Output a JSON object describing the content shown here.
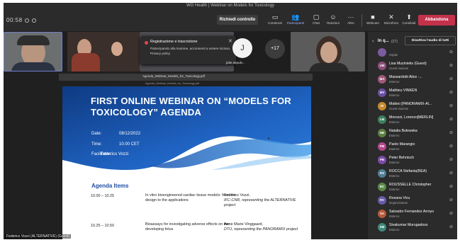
{
  "window": {
    "title": "WG Health | Webinar on Models for Toxicology",
    "timer": "00:58"
  },
  "toolbar": {
    "request_control": "Richiedi controllo",
    "buttons": [
      {
        "label": "Contenuti",
        "icon": "content-icon"
      },
      {
        "label": "Partecipanti",
        "icon": "people-icon"
      },
      {
        "label": "Chat",
        "icon": "chat-icon"
      },
      {
        "label": "Reazioni",
        "icon": "reactions-icon"
      },
      {
        "label": "Altro",
        "icon": "more-icon"
      },
      {
        "label": "Webcam",
        "icon": "camera-icon"
      },
      {
        "label": "Microfono",
        "icon": "mic-off-icon"
      },
      {
        "label": "Condividi",
        "icon": "share-icon"
      }
    ],
    "leave": "Abbandona"
  },
  "recording_popup": {
    "title": "Registrazione e trascrizione",
    "body": "Partecipando alla riunione, acconsenti a essere incluso. Privacy policy"
  },
  "gallery": {
    "avatar_initial": "J",
    "avatar_name": "joke.sepulv...",
    "overflow_count": "+17"
  },
  "document": {
    "filename": "Agenda_Webinar_Models_for_Toxicology.pdf",
    "subtitle": "Agenda_Webinar_Models_for_Toxicology.pdf"
  },
  "slide": {
    "title": "FIRST ONLINE WEBINAR ON “MODELS FOR TOXICOLOGY” AGENDA",
    "date_label": "Date:",
    "date_value": "08/12/2022",
    "time_label": "Time:",
    "time_value": "10.00 CET",
    "facilitator_label": "Facilitator:",
    "facilitator_value": "Federico Vozzi",
    "agenda_heading": "Agenda Items",
    "items": [
      {
        "time": "10.00 – 10.25",
        "title": "In vitro bioengineered cardiac tissue models: from the design to the applications",
        "speaker": "Federico Vozzi,",
        "affiliation": "IFC-CNR, representing the ALTERNATIVE project"
      },
      {
        "time": "10.25 – 10.50",
        "title": "Bioassays for investigating adverse effects on the developing fetus",
        "speaker": "Anne Marie Vinggaard,",
        "affiliation": "DTU, representing the PANORAMIX project"
      }
    ]
  },
  "presenter_tag": "Federico Vozzi (ALTERNATIVE) (Guest)",
  "panel": {
    "label": "In q...",
    "count": "(27)",
    "mute_all": "Disattiva l'audio di tutti",
    "participants": [
      {
        "initials": "",
        "name": "",
        "role": "Ospite",
        "color": "#7a5c9e"
      },
      {
        "initials": "UM",
        "name": "Lisa Muzinieks (Guest)",
        "role": "Guest riunione",
        "color": "#8e4f7a"
      },
      {
        "initials": "MA",
        "name": "Massardotti Alice -...",
        "role": "Esterno",
        "color": "#a2587b"
      },
      {
        "initials": "MV",
        "name": "Mathieu VINKEN",
        "role": "Esterno",
        "color": "#6b4fa5"
      },
      {
        "initials": "M",
        "name": "Matteo [PANORAMIX-Al...",
        "role": "Guest riunione",
        "color": "#c58a2e"
      },
      {
        "initials": "LM",
        "name": "Morozzi, Lorenzo[MERLIN]",
        "role": "Esterno",
        "color": "#3f7f5c"
      },
      {
        "initials": "NB",
        "name": "Natalia Bulewska",
        "role": "Esterno",
        "color": "#5c7f3f"
      },
      {
        "initials": "PM",
        "name": "Paolo Marangio",
        "role": "Esterno",
        "color": "#b5478a"
      },
      {
        "initials": "PB",
        "name": "Peter Behnisch",
        "role": "Esterno",
        "color": "#7d4aa8"
      },
      {
        "initials": "RS",
        "name": "ROCCA Stefania(REA)",
        "role": "Esterno",
        "color": "#4f7f93"
      },
      {
        "initials": "RC",
        "name": "ROUSSELLE Christopher",
        "role": "Esterno",
        "color": "#5b8a4a"
      },
      {
        "initials": "RV",
        "name": "Roxana Vicu",
        "role": "Organizzatore",
        "color": "#6a5aa8"
      },
      {
        "initials": "SA",
        "name": "Salvador Fernandez Arroyo",
        "role": "Esterno",
        "color": "#b55a3a"
      },
      {
        "initials": "SM",
        "name": "Sivakumar Murugadoss",
        "role": "Esterno",
        "color": "#3f8a7a"
      }
    ]
  },
  "colors": {
    "leave": "#c4314b",
    "slide_blue_dark": "#123e86",
    "slide_blue_mid": "#1f63c2",
    "slide_blue_light": "#3a8ee0",
    "agenda_heading": "#1f4ea3"
  }
}
